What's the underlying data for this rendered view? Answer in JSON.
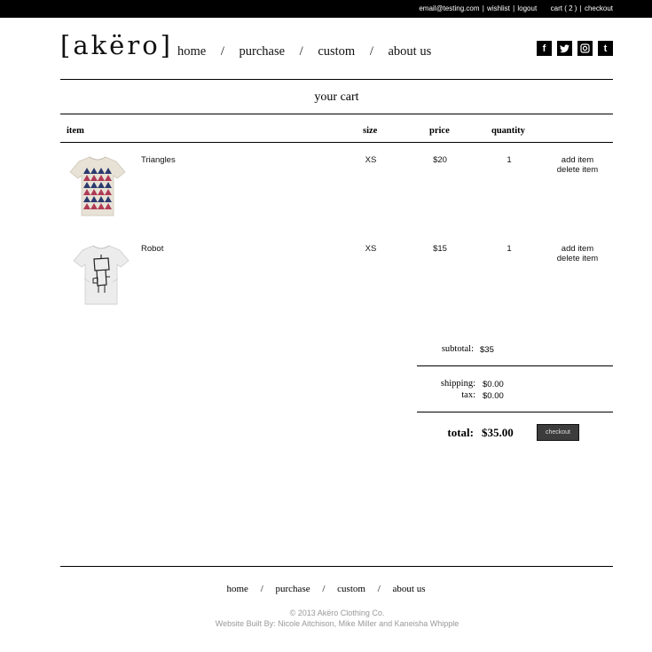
{
  "topbar": {
    "email": "email@testing.com",
    "wishlist": "wishlist",
    "logout": "logout",
    "cart": "cart ( 2 )",
    "checkout": "checkout"
  },
  "brand": {
    "logo": "[akëro]"
  },
  "nav": {
    "home": "home",
    "purchase": "purchase",
    "custom": "custom",
    "about": "about us",
    "separator": "/"
  },
  "social": {
    "facebook": "f",
    "twitter": "t",
    "instagram": "◎",
    "tumblr": "t"
  },
  "cart": {
    "title": "your cart",
    "columns": {
      "item": "item",
      "size": "size",
      "price": "price",
      "quantity": "quantity"
    },
    "items": [
      {
        "name": "Triangles",
        "size": "XS",
        "price": "$20",
        "quantity": "1",
        "add": "add item",
        "delete": "delete item",
        "image_icon": "triangles-tshirt-image"
      },
      {
        "name": "Robot",
        "size": "XS",
        "price": "$15",
        "quantity": "1",
        "add": "add item",
        "delete": "delete item",
        "image_icon": "robot-tshirt-image"
      }
    ]
  },
  "summary": {
    "subtotal_label": "subtotal:",
    "subtotal": "$35",
    "shipping_label": "shipping:",
    "shipping": "$0.00",
    "tax_label": "tax:",
    "tax": "$0.00",
    "total_label": "total:",
    "total": "$35.00",
    "checkout_button": "checkout"
  },
  "footer": {
    "home": "home",
    "purchase": "purchase",
    "custom": "custom",
    "about": "about us",
    "separator": "/",
    "copyright": "© 2013 Akëro Clothing Co.",
    "credits": "Website Built By: Nicole Aitchison, Mike Miller and Kaneisha Whipple"
  },
  "colors": {
    "topbar": "#000000",
    "button": "#3c3c3c",
    "footer_text": "#999999"
  }
}
